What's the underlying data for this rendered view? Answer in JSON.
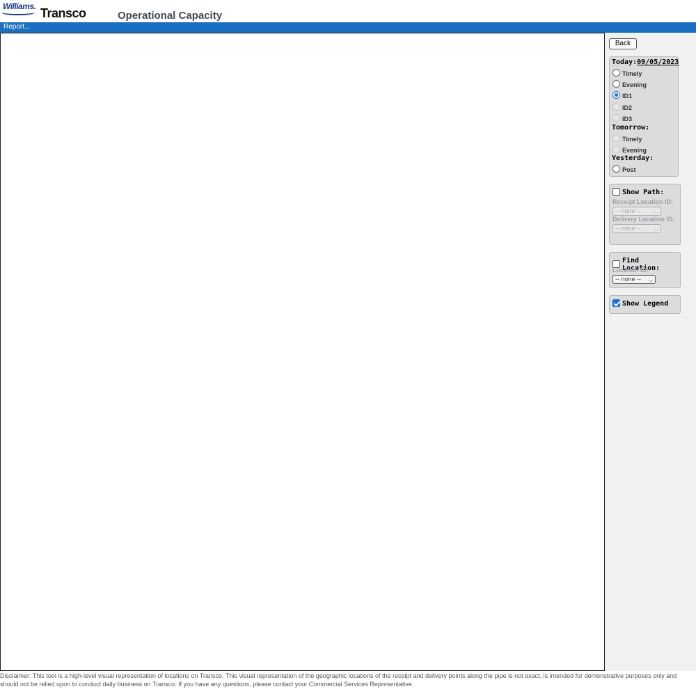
{
  "header": {
    "brand_williams": "Williams.",
    "brand_transco": "Transco",
    "title": "Operational Capacity"
  },
  "menu": {
    "report": "Report..."
  },
  "sidebar": {
    "back_label": "Back",
    "today_label": "Today:",
    "today_date": "09/05/2023",
    "today_options": [
      {
        "label": "Timely",
        "checked": false,
        "disabled": false
      },
      {
        "label": "Evening",
        "checked": false,
        "disabled": false
      },
      {
        "label": "ID1",
        "checked": true,
        "disabled": false
      },
      {
        "label": "ID2",
        "checked": false,
        "disabled": true
      },
      {
        "label": "ID3",
        "checked": false,
        "disabled": true
      }
    ],
    "tomorrow_label": "Tomorrow:",
    "tomorrow_options": [
      {
        "label": "Timely",
        "checked": false,
        "disabled": true
      },
      {
        "label": "Evening",
        "checked": false,
        "disabled": true
      }
    ],
    "yesterday_label": "Yesterday:",
    "yesterday_options": [
      {
        "label": "Post",
        "checked": false,
        "disabled": false
      }
    ],
    "show_path": {
      "label": "Show Path:",
      "checked": false,
      "receipt_label": "Receipt Location ID:",
      "receipt_value": "-- none --",
      "delivery_label": "Delivery Location ID:",
      "delivery_value": "-- none --"
    },
    "find_location": {
      "label": "Find Location:",
      "checked": false,
      "location_label": "Location ID:",
      "location_value": "-- none --"
    },
    "show_legend": {
      "label": "Show Legend",
      "checked": true
    }
  },
  "disclaimer": "Disclaimer: This tool is a high-level visual representation of locations on Transco. This visual representation of the geographic locations of the receipt and delivery points along the pipe is not exact, is intended for demonstrative purposes only and should not be relied upon to conduct daily business on Transco. If you have any questions, please contact your Commercial Services Representative."
}
